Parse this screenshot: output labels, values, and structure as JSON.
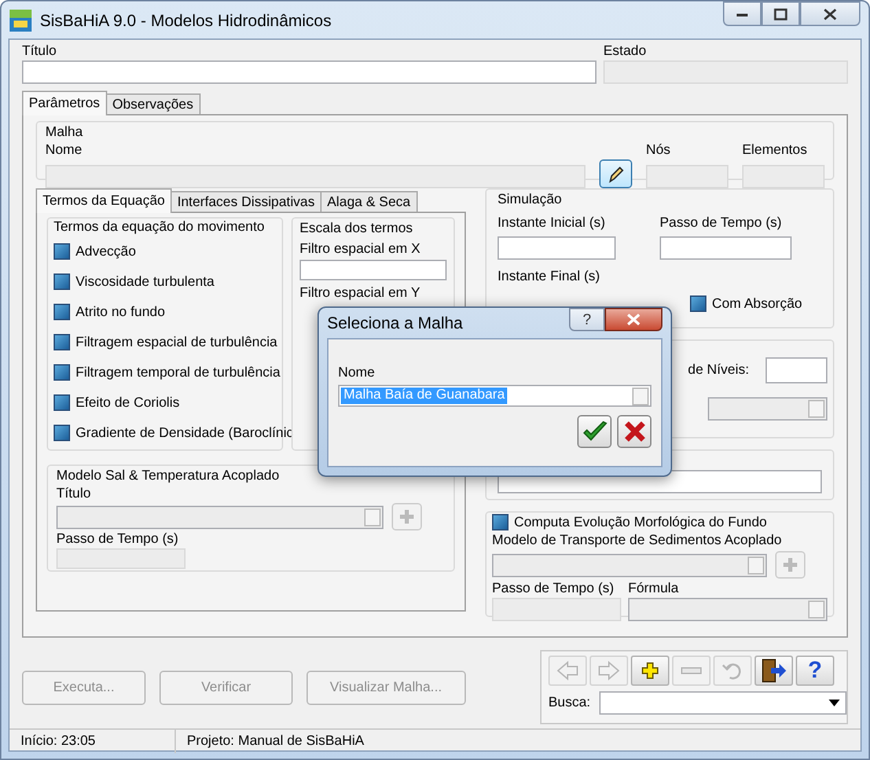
{
  "window": {
    "title": "SisBaHiA 9.0 - Modelos Hidrodinâmicos"
  },
  "header": {
    "title_label": "Título",
    "state_label": "Estado"
  },
  "tabs": [
    {
      "label": "Parâmetros",
      "selected": true
    },
    {
      "label": "Observações",
      "selected": false
    }
  ],
  "mesh_group": {
    "title": "Malha",
    "name_label": "Nome",
    "nodes_label": "Nós",
    "elements_label": "Elementos"
  },
  "inner_tabs": [
    {
      "label": "Termos da Equação",
      "selected": true
    },
    {
      "label": "Interfaces Dissipativas",
      "selected": false
    },
    {
      "label": "Alaga & Seca",
      "selected": false
    }
  ],
  "equation_terms": {
    "title": "Termos da equação do movimento",
    "items": [
      {
        "label": "Advecção",
        "checked": true
      },
      {
        "label": "Viscosidade turbulenta",
        "checked": true
      },
      {
        "label": "Atrito no fundo",
        "checked": true
      },
      {
        "label": "Filtragem espacial de turbulência",
        "checked": true
      },
      {
        "label": "Filtragem temporal de turbulência",
        "checked": true
      },
      {
        "label": "Efeito de Coriolis",
        "checked": true
      },
      {
        "label": "Gradiente de Densidade (Baroclínic",
        "checked": true
      }
    ]
  },
  "scale_group": {
    "title": "Escala dos termos",
    "filter_x_label": "Filtro espacial em X",
    "filter_y_label": "Filtro espacial em Y"
  },
  "salt_temp_group": {
    "title": "Modelo Sal & Temperatura Acoplado",
    "title_label": "Título",
    "time_step_label": "Passo de Tempo (s)"
  },
  "simulation": {
    "title": "Simulação",
    "initial_label": "Instante Inicial (s)",
    "time_step_label": "Passo de Tempo (s)",
    "final_label": "Instante Final (s)",
    "absorption": {
      "label": "Com Absorção",
      "checked": true
    }
  },
  "levels": {
    "label": "de Níveis:"
  },
  "morphology": {
    "compute": {
      "label": "Computa Evolução Morfológica do Fundo",
      "checked": true
    },
    "model_label": "Modelo de Transporte de Sedimentos Acoplado",
    "time_step_label": "Passo de Tempo (s)",
    "formula_label": "Fórmula"
  },
  "buttons": [
    {
      "label": "Executa...",
      "disabled": true
    },
    {
      "label": "Verificar",
      "disabled": true
    },
    {
      "label": "Visualizar Malha...",
      "disabled": true
    }
  ],
  "toolbar": {
    "buttons": [
      {
        "kind": "back",
        "disabled": true
      },
      {
        "kind": "forward",
        "disabled": true
      },
      {
        "kind": "add",
        "disabled": false
      },
      {
        "kind": "remove",
        "disabled": true
      },
      {
        "kind": "undo",
        "disabled": true
      },
      {
        "kind": "exit",
        "disabled": false
      },
      {
        "kind": "help",
        "disabled": false,
        "symbol": "?"
      }
    ],
    "search_label": "Busca:"
  },
  "status_bar": {
    "start": "Início: 23:05",
    "project": "Projeto: Manual de SisBaHiA"
  },
  "dialog": {
    "title": "Seleciona a Malha",
    "help_symbol": "?",
    "name_label": "Nome",
    "value": "Malha Baía de Guanabara"
  }
}
